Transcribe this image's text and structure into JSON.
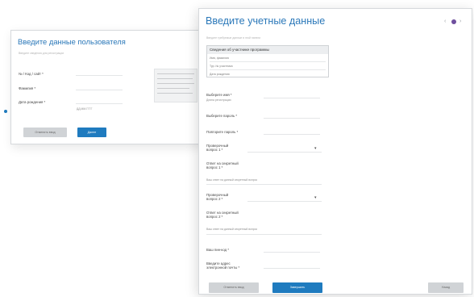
{
  "user_dialog": {
    "title": "Введите данные пользователя",
    "subtitle": "Введите сведения для регистрации",
    "fields": [
      {
        "label": "№ / Код / сайт *"
      },
      {
        "label": "Фамилия *"
      },
      {
        "label": "Дата рождения *",
        "hint": "ДД.ММ.ГГГГ"
      }
    ],
    "buttons": {
      "cancel": "Отменить ввод",
      "next": "Далее"
    }
  },
  "credentials_dialog": {
    "title": "Введите учетные данные",
    "subtitle": "Введите требуемые данные в этой панели",
    "nav": {
      "prev": "‹",
      "next": "›"
    },
    "program_box": {
      "header": "Сведения об участнике программы",
      "rows": [
        "Имя, фамилия",
        "Тур. № участника",
        "Дата рождения"
      ]
    },
    "fields": [
      {
        "label": "Выберите имя *",
        "hint": "Длина регистрации"
      },
      {
        "label": "Выберите пароль *"
      },
      {
        "label": "Повторите пароль *"
      },
      {
        "label": "Проверочный вопрос 1 *",
        "type": "select"
      },
      {
        "label": "Ответ на секретный вопрос 1 *"
      },
      {
        "label": "Проверочный вопрос 2 *",
        "type": "select"
      },
      {
        "label": "Ответ на секретный вопрос 2 *"
      },
      {
        "label": "Ваш пин-код *"
      },
      {
        "label": "Введите адрес электронной почты *"
      }
    ],
    "answer_hint": "Ваш ответ на данный секретный вопрос",
    "buttons": {
      "cancel": "Отменить ввод",
      "submit": "Завершить",
      "back": "Назад"
    }
  },
  "colors": {
    "accent": "#2b78b9",
    "button": "#1f7bbf",
    "step_dot": "#6f4f9e",
    "marker": "#1f7bbf"
  }
}
